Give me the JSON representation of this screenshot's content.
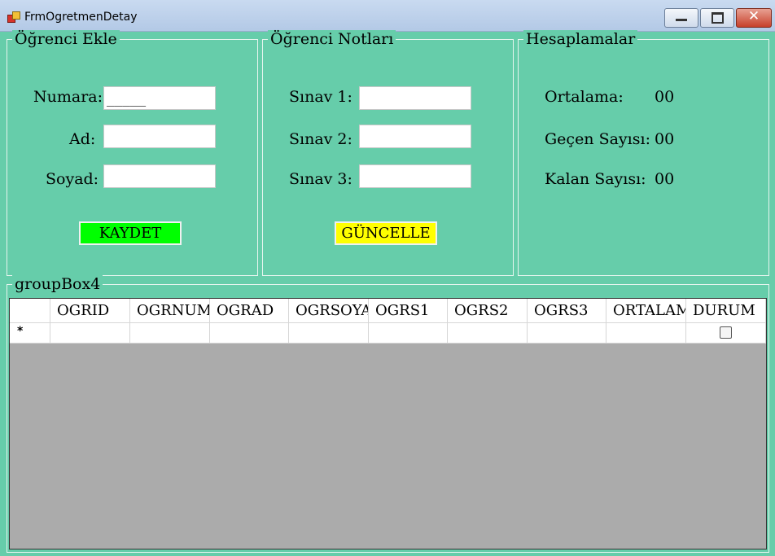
{
  "window": {
    "title": "FrmOgretmenDetay"
  },
  "group1": {
    "title": "Öğrenci Ekle",
    "numara_label": "Numara:",
    "numara_value": "_____",
    "ad_label": "Ad:",
    "soyad_label": "Soyad:",
    "save_button": "KAYDET"
  },
  "group2": {
    "title": "Öğrenci Notları",
    "sinav1_label": "Sınav 1:",
    "sinav2_label": "Sınav 2:",
    "sinav3_label": "Sınav 3:",
    "update_button": "GÜNCELLE"
  },
  "group3": {
    "title": "Hesaplamalar",
    "ortalama_label": "Ortalama:",
    "ortalama_value": "00",
    "gecen_label": "Geçen Sayısı:",
    "gecen_value": "00",
    "kalan_label": "Kalan Sayısı:",
    "kalan_value": "00"
  },
  "group4": {
    "title": "groupBox4",
    "columns": [
      "OGRID",
      "OGRNUMARA",
      "OGRAD",
      "OGRSOYAD",
      "OGRS1",
      "OGRS2",
      "OGRS3",
      "ORTALAMA",
      "DURUM"
    ],
    "new_row_marker": "*"
  },
  "colors": {
    "form_bg": "#66cdaa",
    "save_button": "#00ff00",
    "update_button": "#ffff00"
  }
}
